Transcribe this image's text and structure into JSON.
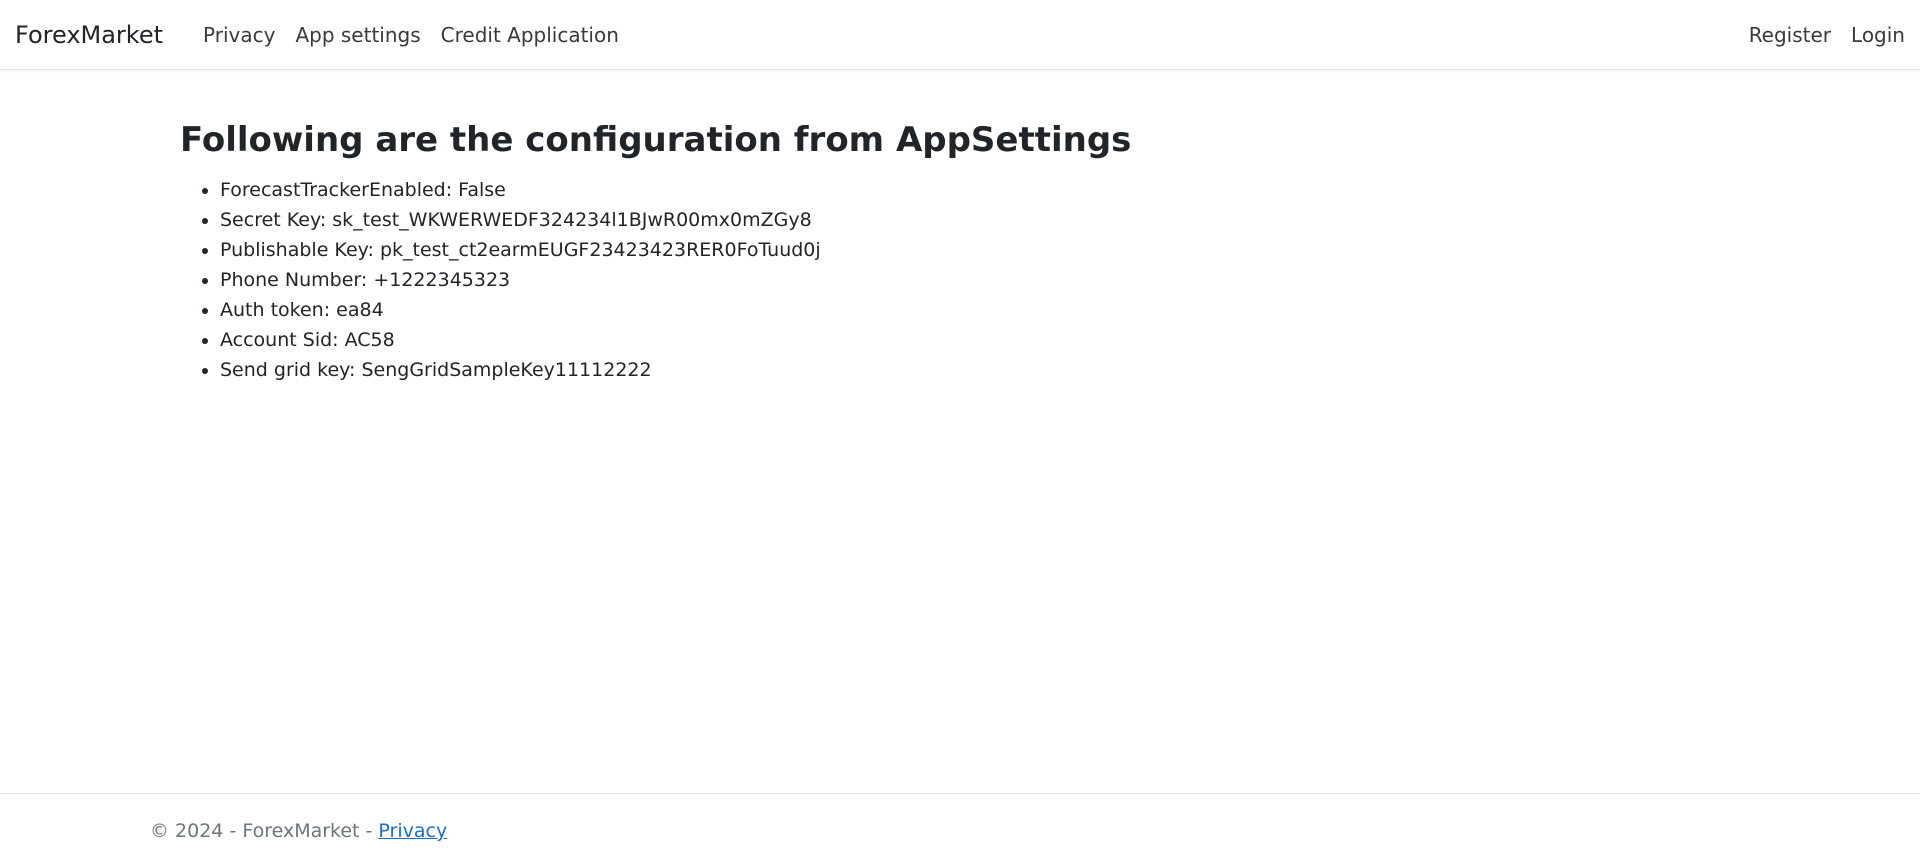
{
  "navbar": {
    "brand": "ForexMarket",
    "links": [
      {
        "label": "Privacy"
      },
      {
        "label": "App settings"
      },
      {
        "label": "Credit Application"
      }
    ],
    "right_links": [
      {
        "label": "Register"
      },
      {
        "label": "Login"
      }
    ]
  },
  "main": {
    "title": "Following are the configuration from AppSettings",
    "items": [
      "ForecastTrackerEnabled: False",
      "Secret Key: sk_test_WKWERWEDF324234l1BJwR00mx0mZGy8",
      "Publishable Key: pk_test_ct2earmEUGF23423423RER0FoTuud0j",
      "Phone Number: +1222345323",
      "Auth token: ea84",
      "Account Sid: AC58",
      "Send grid key: SengGridSampleKey11112222"
    ]
  },
  "footer": {
    "text": "© 2024 - ForexMarket -",
    "link_label": "Privacy"
  },
  "colors": {
    "link": "#1b6ec2",
    "muted": "#6c757d",
    "text": "#212529"
  }
}
